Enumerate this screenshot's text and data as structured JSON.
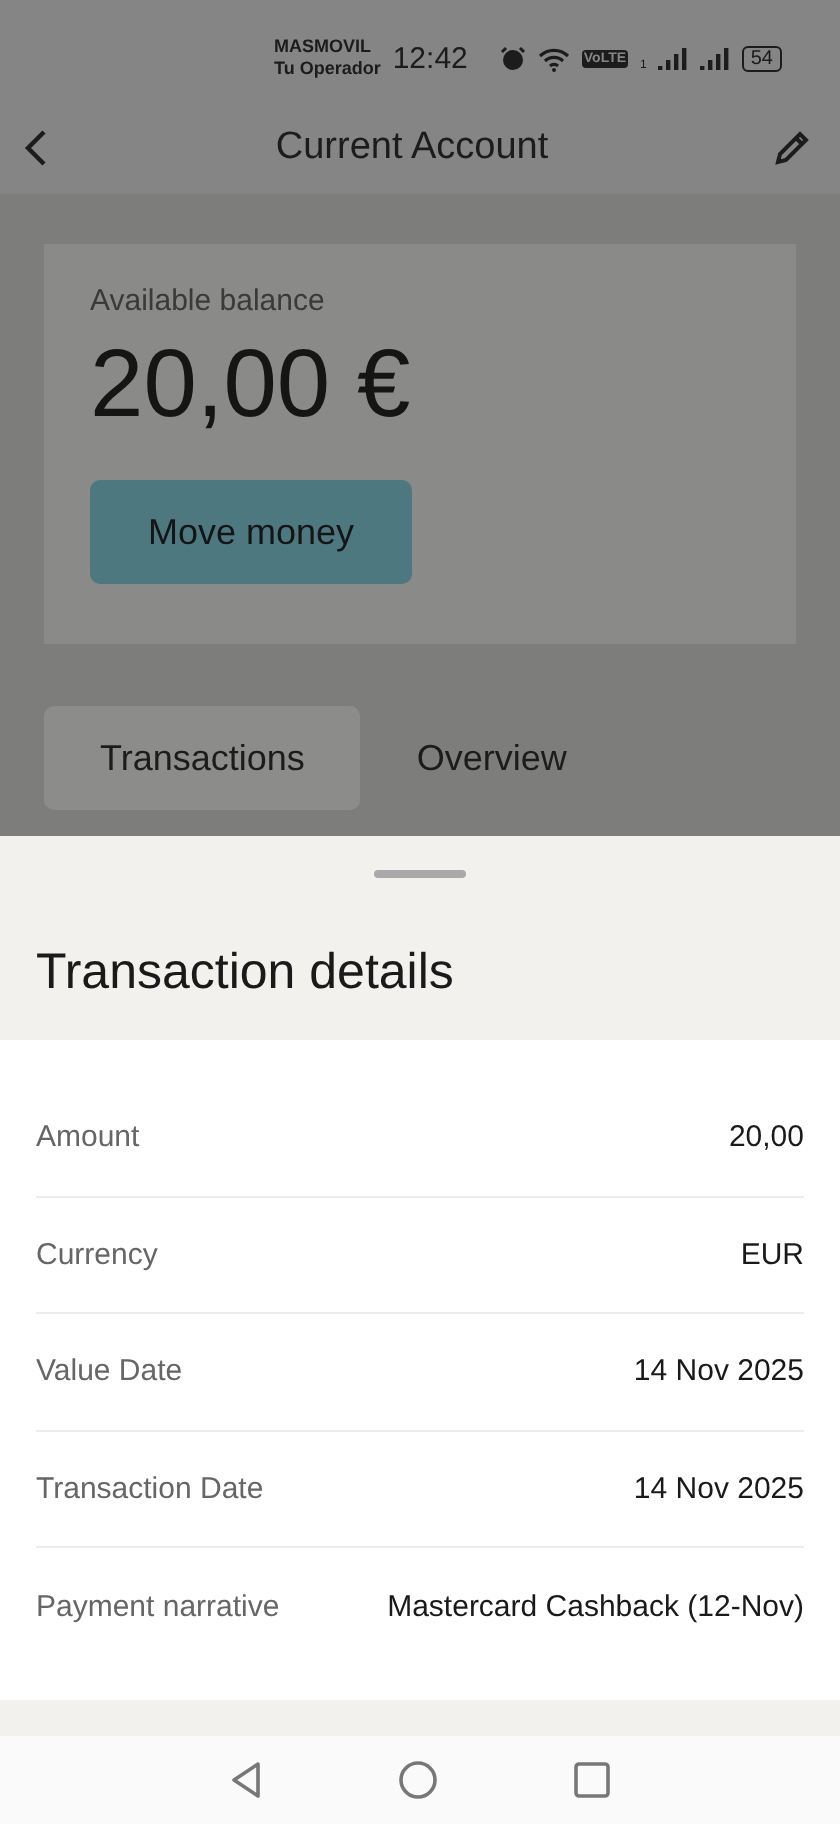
{
  "status_bar": {
    "carrier": "MASMOVIL",
    "operator": "Tu Operador",
    "time": "12:42",
    "volte": "VoLTE",
    "sim": "1",
    "battery": "54"
  },
  "header": {
    "title": "Current Account"
  },
  "balance": {
    "label": "Available balance",
    "amount": "20,00 €",
    "button": "Move money"
  },
  "tabs": [
    {
      "label": "Transactions",
      "selected": true
    },
    {
      "label": "Overview",
      "selected": false
    }
  ],
  "sheet": {
    "title": "Transaction details",
    "rows": [
      {
        "label": "Amount",
        "value": "20,00"
      },
      {
        "label": "Currency",
        "value": "EUR"
      },
      {
        "label": "Value Date",
        "value": "14 Nov 2025"
      },
      {
        "label": "Transaction Date",
        "value": "14 Nov 2025"
      },
      {
        "label": "Payment narrative",
        "value": "Mastercard Cashback (12-Nov)"
      }
    ]
  }
}
